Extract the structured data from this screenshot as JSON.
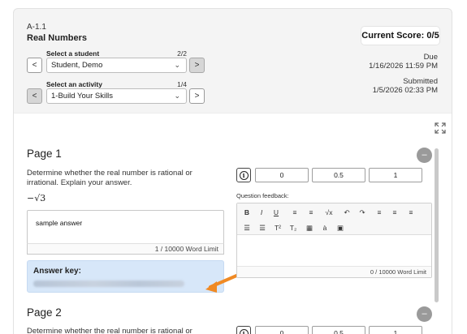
{
  "assignment": {
    "code": "A-1.1",
    "title": "Real Numbers"
  },
  "score": {
    "label": "Current Score:",
    "value": "0/5"
  },
  "student_select": {
    "label": "Select a student",
    "count": "2/2",
    "value": "Student, Demo"
  },
  "activity_select": {
    "label": "Select an activity",
    "count": "1/4",
    "value": "1-Build Your Skills"
  },
  "nav": {
    "prev": "<",
    "next": ">"
  },
  "due": {
    "label": "Due",
    "date": "1/16/2026 11:59 PM"
  },
  "submitted": {
    "label": "Submitted",
    "date": "1/5/2026 02:33 PM"
  },
  "page1": {
    "title": "Page 1",
    "question": "Determine whether the real number is rational or irrational. Explain your answer.",
    "math": "−√3",
    "answer": "sample answer",
    "word_limit": "1 / 10000 Word Limit",
    "answer_key_title": "Answer key:",
    "collapse": "–"
  },
  "grading": {
    "score_options": [
      "0",
      "0.5",
      "1"
    ],
    "feedback_label": "Question feedback:",
    "feedback_word_limit": "0 / 10000 Word Limit"
  },
  "toolbar": {
    "row1": [
      "B",
      "I",
      "U",
      "≡",
      "≡",
      "√x",
      "↶",
      "↷",
      "≡",
      "≡",
      "≡"
    ],
    "row2": [
      "☰",
      "☰",
      "T²",
      "T₂",
      "▦",
      "à",
      "▣"
    ]
  },
  "page2": {
    "title": "Page 2",
    "question": "Determine whether the real number is rational or irrational.",
    "collapse": "–",
    "score_options": [
      "0",
      "0.5",
      "1"
    ]
  },
  "colors": {
    "key_bg": "#d7e7f9",
    "arrow": "#f08a24",
    "collapse_bg": "#9a9a9a"
  },
  "icons": {
    "expand": "expand-arrows-icon",
    "info": "info-circle-icon"
  }
}
